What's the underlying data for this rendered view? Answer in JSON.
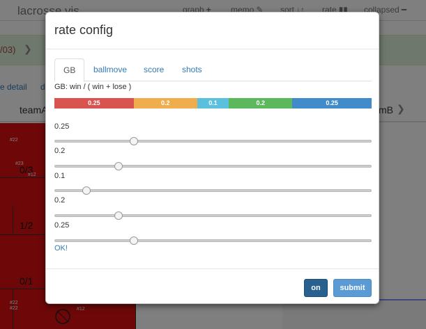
{
  "app": {
    "brand": "lacrosse vis",
    "nav": [
      {
        "label": "graph",
        "glyph": "+"
      },
      {
        "label": "memo",
        "glyph": "✎"
      },
      {
        "label": "sort",
        "glyph": "↓↑"
      },
      {
        "label": "rate",
        "glyph": "▮▮"
      },
      {
        "label": "collapsed",
        "glyph": "━"
      }
    ],
    "alert_text": "/03)",
    "link_detail": "e detail",
    "link_d": "d",
    "th_left": "teamA",
    "th_right": "mB",
    "cells": [
      "0/3",
      "1/2",
      "0/1"
    ],
    "tags": [
      "#22",
      "#23",
      "#12",
      "#22",
      "#22",
      "#12"
    ]
  },
  "modal": {
    "title": "rate config",
    "tabs": [
      {
        "label": "GB",
        "active": true
      },
      {
        "label": "ballmove",
        "active": false
      },
      {
        "label": "score",
        "active": false
      },
      {
        "label": "shots",
        "active": false
      }
    ],
    "formula": "GB: win / ( win + lose )",
    "segments": [
      {
        "label": "0.25",
        "value": 0.25,
        "color": "#d9534f"
      },
      {
        "label": "0.2",
        "value": 0.2,
        "color": "#f0ad4e"
      },
      {
        "label": "0.1",
        "value": 0.1,
        "color": "#5bc0de"
      },
      {
        "label": "0.2",
        "value": 0.2,
        "color": "#5cb85c"
      },
      {
        "label": "0.25",
        "value": 0.25,
        "color": "#428bca"
      }
    ],
    "sliders": [
      {
        "label": "0.25",
        "value": 0.25
      },
      {
        "label": "0.2",
        "value": 0.2
      },
      {
        "label": "0.1",
        "value": 0.1
      },
      {
        "label": "0.2",
        "value": 0.2
      },
      {
        "label": "0.25",
        "value": 0.25
      }
    ],
    "ok_label": "OK!",
    "buttons": {
      "on": "on",
      "submit": "submit"
    }
  }
}
